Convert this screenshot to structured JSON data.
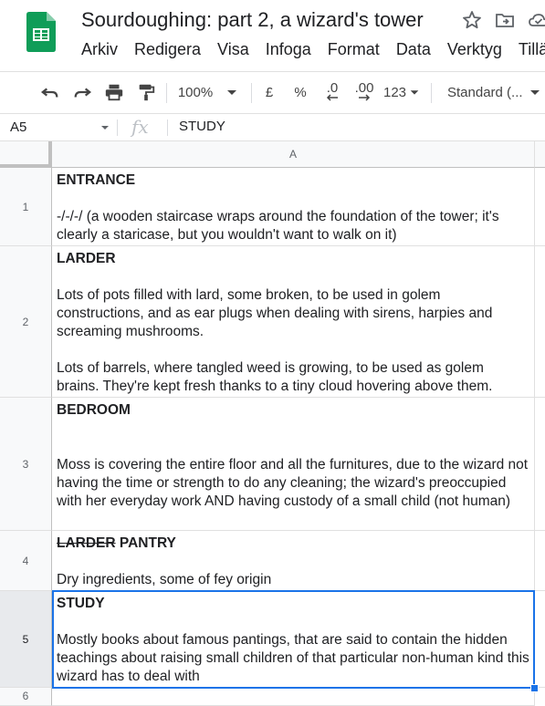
{
  "app": {
    "title": "Sourdoughing: part 2, a wizard's tower",
    "menus": [
      "Arkiv",
      "Redigera",
      "Visa",
      "Infoga",
      "Format",
      "Data",
      "Verktyg",
      "Tilläg"
    ]
  },
  "toolbar": {
    "zoom": "100%",
    "currency": "£",
    "percent": "%",
    "dec_less": ".0",
    "dec_more": ".00",
    "more_formats": "123",
    "font": "Standard (..."
  },
  "formula_bar": {
    "name_box": "A5",
    "fx": "fx",
    "value": "STUDY"
  },
  "grid": {
    "column_header": "A",
    "rows": [
      {
        "num": "1",
        "title": "ENTRANCE",
        "title_strike": "",
        "body": "\n-/-/-/ (a wooden staircase wraps around the foundation of the tower; it's clearly a staricase, but you wouldn't want to walk on it)"
      },
      {
        "num": "2",
        "title": "LARDER",
        "title_strike": "",
        "body": "\nLots of pots filled with lard, some broken, to be used in golem constructions, and as ear plugs when dealing with sirens, harpies and screaming mushrooms.\n\nLots of barrels, where tangled weed is growing, to be used as golem brains. They're kept fresh thanks to a tiny cloud hovering above them."
      },
      {
        "num": "3",
        "title": "BEDROOM",
        "title_strike": "",
        "body": "\n\nMoss is covering the entire floor and all the furnitures, due to the wizard not having the time or strength to do any cleaning; the wizard's preoccupied with her everyday work AND having custody of a small child (not human)"
      },
      {
        "num": "4",
        "title": " PANTRY",
        "title_strike": "LARDER",
        "body": "\nDry ingredients, some of fey origin"
      },
      {
        "num": "5",
        "title": "STUDY",
        "title_strike": "",
        "body": "\nMostly books about famous pantings, that are said to contain the hidden teachings about raising small children of that particular non-human kind this wizard has to deal with"
      }
    ],
    "next_row": "6"
  }
}
